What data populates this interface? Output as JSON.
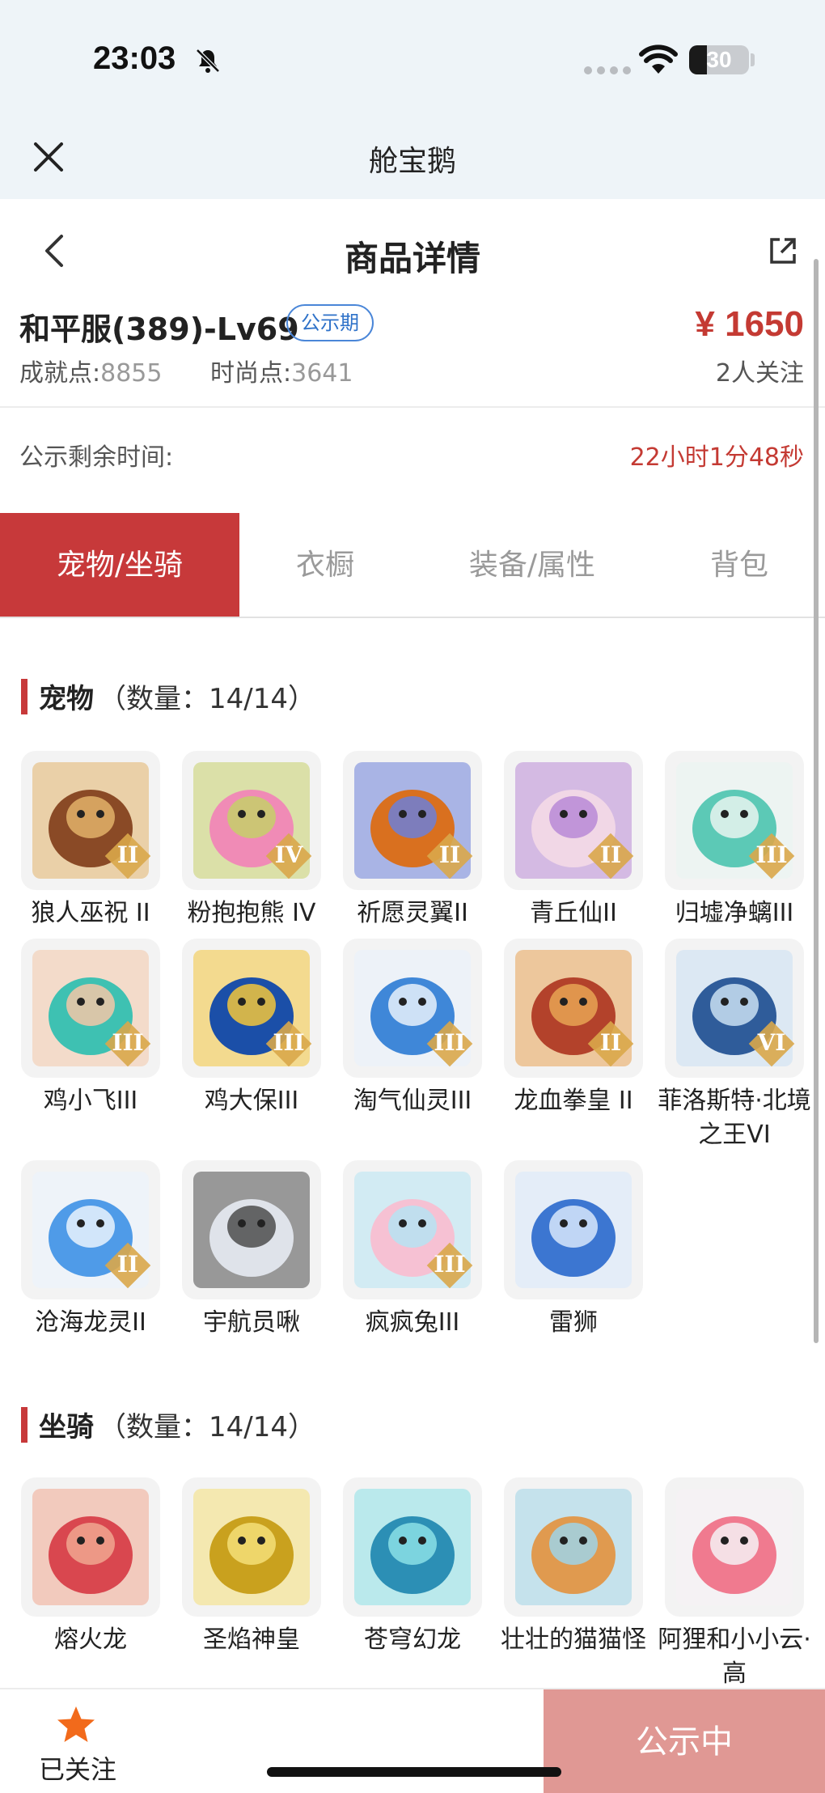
{
  "status_bar": {
    "time": "23:03",
    "battery": "30",
    "battery_level": 0.3
  },
  "app": {
    "title": "舱宝鹅"
  },
  "header": {
    "title": "商品详情"
  },
  "listing": {
    "server_title": "和平服(389)-Lv69",
    "badge": "公示期",
    "price": "¥ 1650",
    "achievement_label": "成就点:",
    "achievement_value": "8855",
    "fashion_label": "时尚点:",
    "fashion_value": "3641",
    "followers": "2人关注",
    "countdown_label": "公示剩余时间:",
    "countdown_value": "22小时1分48秒"
  },
  "tabs": [
    {
      "label": "宠物/坐骑",
      "active": true
    },
    {
      "label": "衣橱",
      "active": false
    },
    {
      "label": "装备/属性",
      "active": false
    },
    {
      "label": "背包",
      "active": false
    }
  ],
  "pets": {
    "title": "宠物",
    "count": "（数量：14/14）",
    "items": [
      {
        "name": "狼人巫祝 II",
        "tier": "II",
        "colors": [
          "#8a4a26",
          "#e2b26a"
        ]
      },
      {
        "name": "粉抱抱熊 IV",
        "tier": "IV",
        "colors": [
          "#f08bb6",
          "#c6cf6a"
        ]
      },
      {
        "name": "祈愿灵翼II",
        "tier": "II",
        "colors": [
          "#d9701f",
          "#6c7fd8"
        ]
      },
      {
        "name": "青丘仙II",
        "tier": "II",
        "colors": [
          "#f1d7e6",
          "#b98ad6"
        ]
      },
      {
        "name": "归墟净螭III",
        "tier": "III",
        "colors": [
          "#5cc9b6",
          "#e7f4f0"
        ]
      },
      {
        "name": "鸡小飞III",
        "tier": "III",
        "colors": [
          "#3ec1b2",
          "#f3c7a7"
        ]
      },
      {
        "name": "鸡大保III",
        "tier": "III",
        "colors": [
          "#1b4fa8",
          "#f2c53c"
        ]
      },
      {
        "name": "淘气仙灵III",
        "tier": "III",
        "colors": [
          "#3f87d8",
          "#e8f1fb"
        ]
      },
      {
        "name": "龙血拳皇 II",
        "tier": "II",
        "colors": [
          "#b3422b",
          "#e7a354"
        ]
      },
      {
        "name": "菲洛斯特·北境之王VI",
        "tier": "VI",
        "colors": [
          "#2f5c9a",
          "#c9dff2"
        ]
      },
      {
        "name": "沧海龙灵II",
        "tier": "II",
        "colors": [
          "#4f9be8",
          "#e9f3fd"
        ]
      },
      {
        "name": "宇航员啾",
        "tier": "",
        "colors": [
          "#dfe3ea",
          "#4d4d4d"
        ]
      },
      {
        "name": "疯疯兔III",
        "tier": "III",
        "colors": [
          "#f6c1d3",
          "#b6e3f2"
        ]
      },
      {
        "name": "雷狮",
        "tier": "",
        "colors": [
          "#3c76d1",
          "#d7e8fb"
        ]
      }
    ]
  },
  "mounts": {
    "title": "坐骑",
    "count": "（数量：14/14）",
    "items": [
      {
        "name": "熔火龙",
        "tier": "",
        "colors": [
          "#d9474f",
          "#f0a78f"
        ]
      },
      {
        "name": "圣焰神皇",
        "tier": "",
        "colors": [
          "#c9a11e",
          "#f4df78"
        ]
      },
      {
        "name": "苍穹幻龙",
        "tier": "",
        "colors": [
          "#2c8fb5",
          "#8be0e6"
        ]
      },
      {
        "name": "壮壮的猫猫怪",
        "tier": "",
        "colors": [
          "#e09a4f",
          "#9fd3e6"
        ]
      },
      {
        "name": "阿狸和小小云·高",
        "tier": "",
        "colors": [
          "#f07a8f",
          "#f6f1f4"
        ]
      }
    ]
  },
  "bottom_bar": {
    "follow_label": "已关注",
    "status_button": "公示中"
  }
}
